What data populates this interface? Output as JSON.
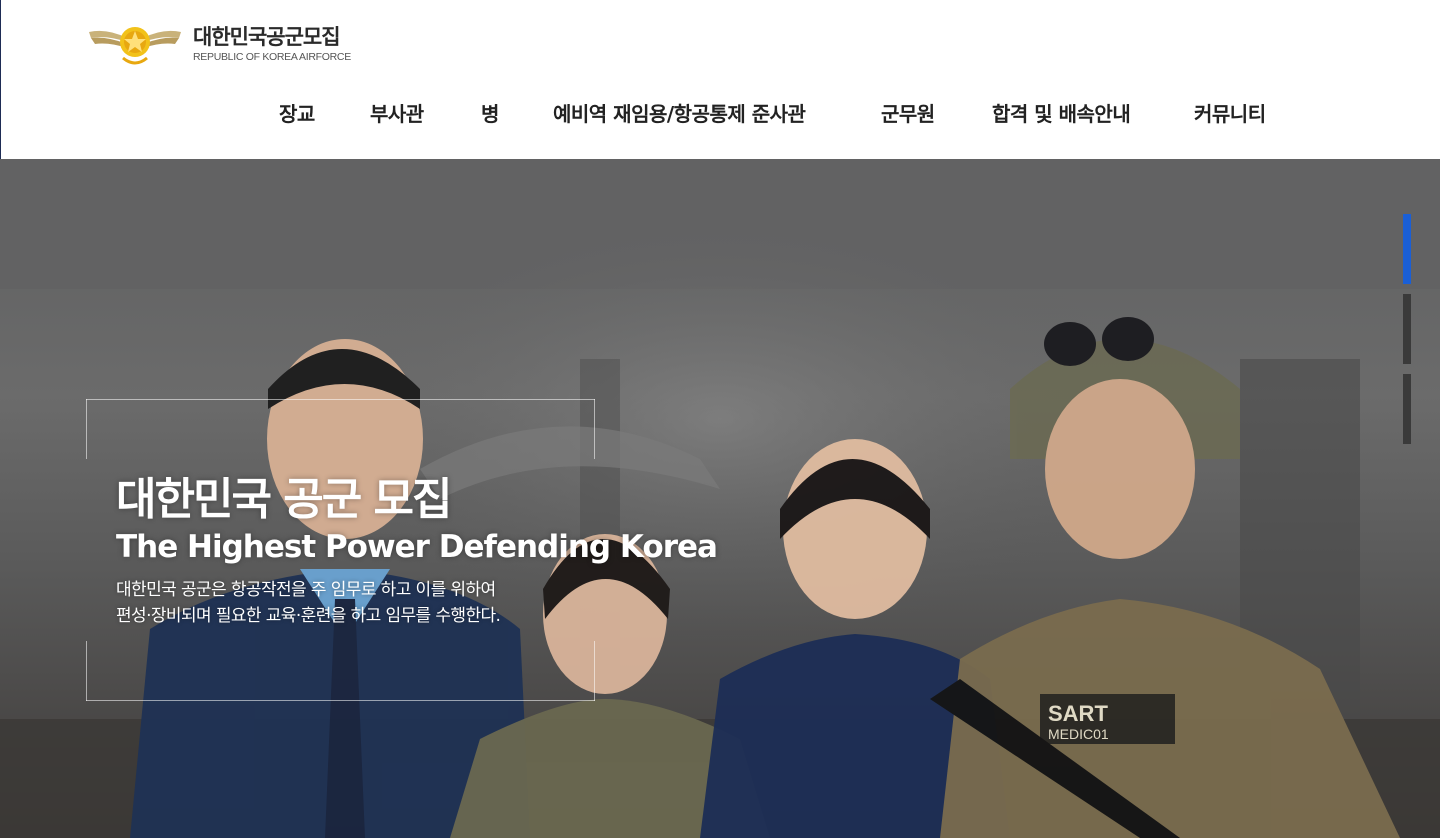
{
  "brand": {
    "title": "대한민국공군모집",
    "subtitle": "REPUBLIC OF KOREA AIRFORCE",
    "emblem_icon": "air-force-emblem-icon"
  },
  "nav": {
    "items": [
      {
        "label": "장교"
      },
      {
        "label": "부사관"
      },
      {
        "label": "병"
      },
      {
        "label": "예비역 재임용/항공통제 준사관"
      },
      {
        "label": "군무원"
      },
      {
        "label": "합격 및 배속안내"
      },
      {
        "label": "커뮤니티"
      }
    ]
  },
  "hero": {
    "title": "대한민국 공군 모집",
    "subtitle": "The Highest Power Defending Korea",
    "desc_line1": "대한민국 공군은 항공작전을 주 임무로 하고 이를 위하여",
    "desc_line2": "편성·장비되며 필요한 교육·훈련을 하고 임무를 수행한다.",
    "patch_text1": "SART",
    "patch_text2": "MEDIC01"
  },
  "slider": {
    "count": 3,
    "active_index": 0,
    "active_color": "#1a5fd6",
    "inactive_color": "#3a3a3a"
  }
}
